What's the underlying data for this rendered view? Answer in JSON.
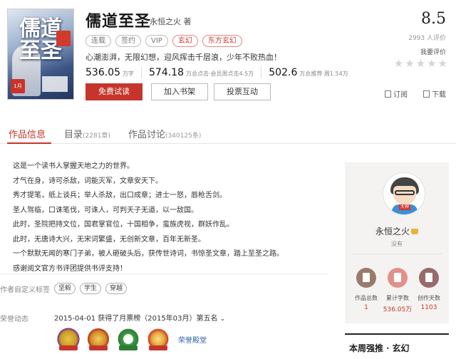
{
  "book": {
    "title": "儒道至圣",
    "author_name": "永恒之火",
    "author_suffix": "著",
    "tags": [
      "连载",
      "签约",
      "VIP",
      "玄幻",
      "东方玄幻"
    ],
    "intro": "心潮澎湃，无限幻想，迎风挥击千层浪，少年不败热血！",
    "stats": [
      {
        "num": "536.05",
        "unit": "万字"
      },
      {
        "num": "574.18",
        "unit": "万总点击·会员周点击4.5万"
      },
      {
        "num": "502.6",
        "unit": "万总推荐·周1.54万"
      }
    ],
    "buttons": {
      "read": "免费试读",
      "shelf": "加入书架",
      "vote": "投票互动"
    },
    "score": "8.5",
    "score_count": "2993 人评价",
    "my_rating": "我要评价",
    "stars": [
      "★",
      "★",
      "★",
      "★",
      "★"
    ],
    "subscribe": "订阅",
    "download": "下载",
    "cover": {
      "title": "儒道至圣",
      "seal": "1月",
      "color_accent": "#c8342b"
    }
  },
  "tabs": [
    {
      "label": "作品信息",
      "count": ""
    },
    {
      "label": "目录",
      "count": "(2281章)"
    },
    {
      "label": "作品讨论",
      "count": "(340125条)"
    }
  ],
  "description": [
    "这是一个读书人掌握天地之力的世界。",
    "才气在身，诗可杀敌，词能灭军，文章安天下。",
    "秀才提笔，纸上谈兵；举人杀敌，出口成章；进士一怒，唇枪舌剑。",
    "圣人驾临，口诛笔伐，可诛人，可判天子无道，以一敌国。",
    "此时，圣院把持文位，国君掌官位，十国相争，蛮族虎视，群妖作乱。",
    "此时，无唐诗大兴，无宋词繁盛，无创新文章，百年无新圣。",
    "一个默默无闻的寒门子弟，被人砸破头后，获传世诗词，书惊圣文章，踏上至圣之路。",
    "感谢阅文官方书评团提供书评支持！"
  ],
  "user_tags_label": "作者自定义标签",
  "user_tags": [
    "坚毅",
    "学生",
    "穿越"
  ],
  "honor_label": "荣誉动态",
  "honor_text": "2015-04-01 获得了月票榜（2015年03月）第五名",
  "honor_chevron": "⌄",
  "honor_link": "荣誉殿堂",
  "author_panel": {
    "name": "永恒之火",
    "avatar_tag": "大神",
    "sub": "没有",
    "stats": [
      {
        "label": "作品总数",
        "value": "1"
      },
      {
        "label": "累计字数",
        "value": "536.05万"
      },
      {
        "label": "创作天数",
        "value": "1103"
      }
    ]
  },
  "recommend_title": "本周强推 · 玄幻",
  "colors": {
    "accent": "#c6352b",
    "panel_bg": "#f4f3f1"
  }
}
